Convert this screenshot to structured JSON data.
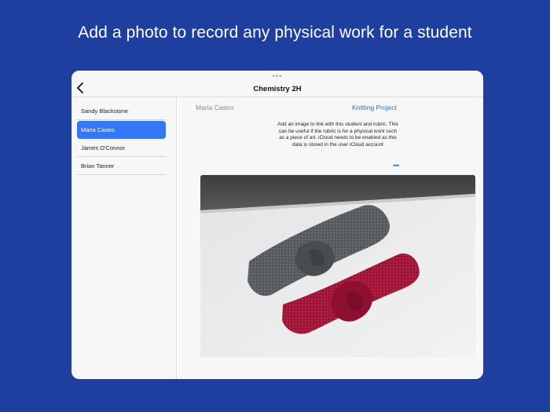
{
  "headline": "Add a photo to record any physical work for a student",
  "navbar": {
    "title": "Chemistry 2H",
    "grabber": "•••",
    "back_icon": "chevron-left-icon"
  },
  "sidebar": {
    "items": [
      {
        "label": "Sandy Blackstone",
        "selected": false
      },
      {
        "label": "Maria Castro",
        "selected": true
      },
      {
        "label": "James O'Connor",
        "selected": false
      },
      {
        "label": "Brian Tanner",
        "selected": false
      }
    ]
  },
  "detail": {
    "student_name": "Maria Castro",
    "project_link": "Knitting Project",
    "description": "Add an image to link with this student and rubric. This can be useful if the rubric is for a physical work such as a piece of art. iCloud needs to be enabled as this data is stored in the user iCloud account",
    "more_icon": "ellipsis-icon",
    "more_label": "•••",
    "photo_icon": "knitted-headbands-photo"
  },
  "colors": {
    "background": "#1f3fa0",
    "accent": "#3478f6",
    "link": "#2e6fd8",
    "grey_headband": "#55585a",
    "red_headband": "#a3173a"
  }
}
